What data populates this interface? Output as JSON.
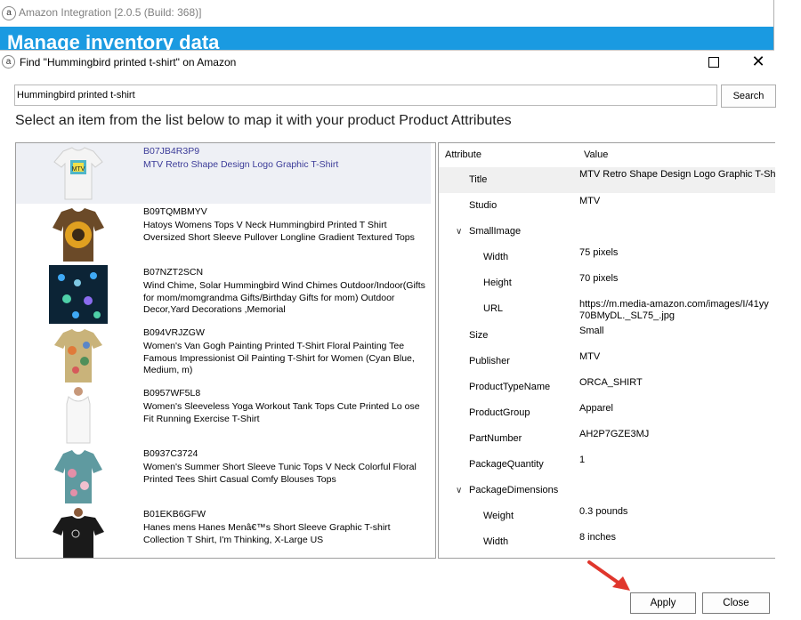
{
  "parent_window": {
    "title": "Amazon Integration [2.0.5 (Build: 368)]",
    "banner": "Manage inventory data"
  },
  "dialog": {
    "title": "Find \"Hummingbird printed t-shirt\" on Amazon",
    "search_value": "Hummingbird printed t-shirt",
    "search_button": "Search",
    "instruction": "Select an item from the list below to map it with your product Product Attributes",
    "apply_button": "Apply",
    "close_button": "Close"
  },
  "results": [
    {
      "asin": "B07JB4R3P9",
      "title": "MTV Retro Shape Design Logo Graphic T-Shirt",
      "selected": true,
      "thumbnail": "white-tshirt-thumbnail"
    },
    {
      "asin": "B09TQMBMYV",
      "title": "Hatoys Womens Tops V Neck Hummingbird Printed T Shirt Oversized Short Sleeve Pullover Longline Gradient Textured Tops",
      "thumbnail": "sunflower-tshirt-thumbnail"
    },
    {
      "asin": "B07NZT2SCN",
      "title": "Wind Chime, Solar Hummingbird Wind Chimes Outdoor/Indoor(Gifts for mom/momgrandma Gifts/Birthday Gifts for mom) Outdoor Decor,Yard Decorations ,Memorial",
      "thumbnail": "wind-chime-thumbnail"
    },
    {
      "asin": "B094VRJZGW",
      "title": "Women's Van Gogh Painting Printed T-Shirt Floral Painting Tee Famous Impressionist Oil Painting T-Shirt for Women (Cyan Blue, Medium, m)",
      "thumbnail": "floral-tshirt-thumbnail"
    },
    {
      "asin": "B0957WF5L8",
      "title": "Women's Sleeveless Yoga Workout Tank Tops Cute Printed Lo ose Fit Running Exercise T-Shirt",
      "thumbnail": "white-tank-thumbnail"
    },
    {
      "asin": "B0937C3724",
      "title": "Women's Summer Short Sleeve Tunic Tops V Neck Colorful Floral Printed Tees Shirt Casual Comfy Blouses Tops",
      "thumbnail": "floral-tunic-thumbnail"
    },
    {
      "asin": "B01EKB6GFW",
      "title": "Hanes mens Hanes Menâ€™s Short Sleeve Graphic T-shirt Collection T Shirt, I'm Thinking, X-Large US",
      "thumbnail": "black-tshirt-thumbnail"
    }
  ],
  "attributes": {
    "header_attribute": "Attribute",
    "header_value": "Value",
    "rows": [
      {
        "name": "Title",
        "value": "MTV Retro Shape Design Logo Graphic T-Shirt",
        "level": 1,
        "highlighted": true
      },
      {
        "name": "Studio",
        "value": "MTV",
        "level": 1
      },
      {
        "name": "SmallImage",
        "value": "",
        "level": 0,
        "expanded": true
      },
      {
        "name": "Width",
        "value": "75 pixels",
        "level": 2
      },
      {
        "name": "Height",
        "value": "70 pixels",
        "level": 2
      },
      {
        "name": "URL",
        "value": "https://m.media-amazon.com/images/I/41yy 70BMyDL._SL75_.jpg",
        "level": 2
      },
      {
        "name": "Size",
        "value": "Small",
        "level": 1
      },
      {
        "name": "Publisher",
        "value": "MTV",
        "level": 1
      },
      {
        "name": "ProductTypeName",
        "value": "ORCA_SHIRT",
        "level": 1
      },
      {
        "name": "ProductGroup",
        "value": "Apparel",
        "level": 1
      },
      {
        "name": "PartNumber",
        "value": "AH2P7GZE3MJ",
        "level": 1
      },
      {
        "name": "PackageQuantity",
        "value": "1",
        "level": 1
      },
      {
        "name": "PackageDimensions",
        "value": "",
        "level": 0,
        "expanded": true
      },
      {
        "name": "Weight",
        "value": "0.3 pounds",
        "level": 2
      },
      {
        "name": "Width",
        "value": "8 inches",
        "level": 2
      }
    ]
  },
  "colors": {
    "banner": "#1a9ae1",
    "selected_row": "#eef0f5",
    "selected_text": "#3b3b98",
    "arrow": "#e0362c"
  }
}
